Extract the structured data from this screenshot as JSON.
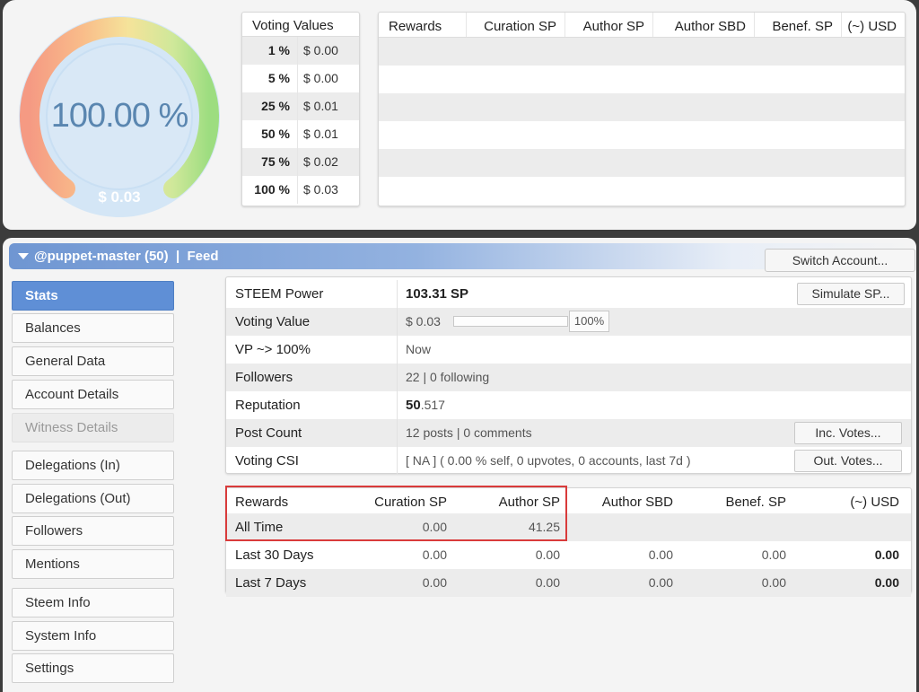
{
  "gauge": {
    "percent_text": "100.00 %",
    "usd_text": "$ 0.03",
    "level": 1.0
  },
  "voting_values": {
    "title": "Voting Values",
    "rows": [
      {
        "pct": "1 %",
        "usd": "$ 0.00"
      },
      {
        "pct": "5 %",
        "usd": "$ 0.00"
      },
      {
        "pct": "25 %",
        "usd": "$ 0.01"
      },
      {
        "pct": "50 %",
        "usd": "$ 0.01"
      },
      {
        "pct": "75 %",
        "usd": "$ 0.02"
      },
      {
        "pct": "100 %",
        "usd": "$ 0.03"
      }
    ]
  },
  "top_rewards": {
    "headers": [
      "Rewards",
      "Curation SP",
      "Author SP",
      "Author SBD",
      "Benef. SP",
      "(~) USD"
    ]
  },
  "account_bar": {
    "title": "@puppet-master (50)  |  Feed",
    "switch_label": "Switch Account..."
  },
  "nav": {
    "items": [
      {
        "label": "Stats"
      },
      {
        "label": "Balances"
      },
      {
        "label": "General Data"
      },
      {
        "label": "Account Details"
      },
      {
        "label": "Witness Details"
      },
      {
        "label": "Delegations (In)"
      },
      {
        "label": "Delegations (Out)"
      },
      {
        "label": "Followers"
      },
      {
        "label": "Mentions"
      },
      {
        "label": "Steem Info"
      },
      {
        "label": "System Info"
      },
      {
        "label": "Settings"
      }
    ]
  },
  "stats": {
    "steem_power": {
      "label": "STEEM Power",
      "value": "103.31 SP",
      "button": "Simulate SP..."
    },
    "voting_value": {
      "label": "Voting Value",
      "value": "$ 0.03",
      "pct": "100%",
      "level": 0.0
    },
    "vp": {
      "label": "VP ~> 100%",
      "value": "Now"
    },
    "followers": {
      "label": "Followers",
      "value": "22 | 0 following"
    },
    "reputation": {
      "label": "Reputation",
      "whole": "50",
      "frac": ".517"
    },
    "post_count": {
      "label": "Post Count",
      "value": "12 posts | 0 comments",
      "button": "Inc. Votes..."
    },
    "voting_csi": {
      "label": "Voting CSI",
      "value": "[ NA ] ( 0.00 % self, 0 upvotes, 0 accounts, last 7d )",
      "button": "Out. Votes..."
    }
  },
  "rewards": {
    "headers": [
      "Rewards",
      "Curation SP",
      "Author SP",
      "Author SBD",
      "Benef. SP",
      "(~) USD"
    ],
    "rows": [
      {
        "label": "All Time",
        "curation": "0.00",
        "author": "41.25",
        "sbd": "",
        "benef": "",
        "usd": ""
      },
      {
        "label": "Last 30 Days",
        "curation": "0.00",
        "author": "0.00",
        "sbd": "0.00",
        "benef": "0.00",
        "usd": "0.00"
      },
      {
        "label": "Last 7 Days",
        "curation": "0.00",
        "author": "0.00",
        "sbd": "0.00",
        "benef": "0.00",
        "usd": "0.00"
      }
    ]
  }
}
